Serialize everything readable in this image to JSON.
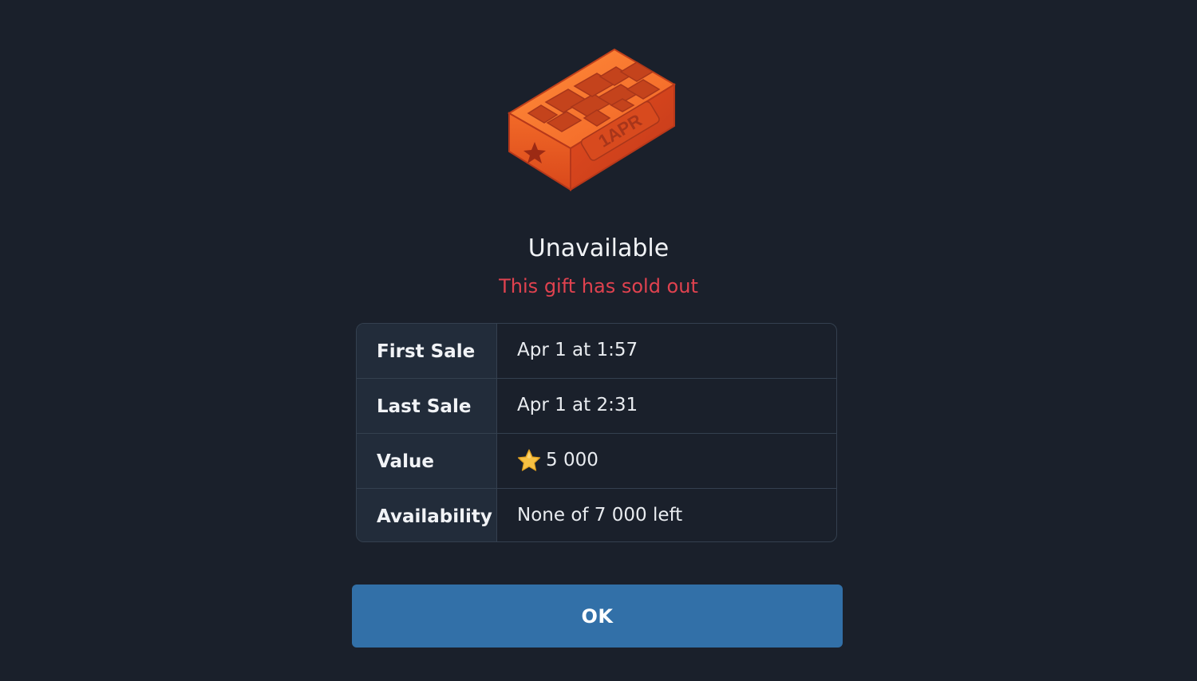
{
  "gift": {
    "image_label": "1APR",
    "icon": "brick-icon"
  },
  "title": "Unavailable",
  "subtitle": "This gift has sold out",
  "colors": {
    "background": "#1a202b",
    "subtitle_red": "#e0424f",
    "button_blue": "#3270a8",
    "brick_orange": "#f06a2a"
  },
  "details": [
    {
      "label": "First Sale",
      "value": "Apr 1 at 1:57"
    },
    {
      "label": "Last Sale",
      "value": "Apr 1 at 2:31"
    },
    {
      "label": "Value",
      "value": "5 000",
      "icon": "star-icon"
    },
    {
      "label": "Availability",
      "value": "None of 7 000 left"
    }
  ],
  "button": {
    "label": "OK"
  }
}
